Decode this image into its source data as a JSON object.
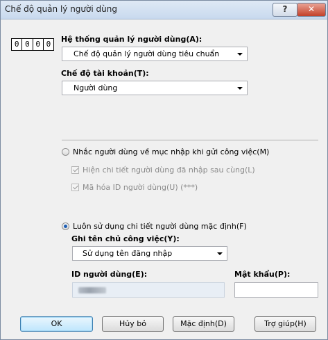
{
  "window": {
    "title": "Chế độ quản lý người dùng",
    "help_glyph": "?",
    "close_glyph": "✕"
  },
  "code_sticker": [
    "0",
    "0",
    "0",
    "0"
  ],
  "user_mgmt_system": {
    "label": "Hệ thống quản lý người dùng(A):",
    "value": "Chế độ quản lý người dùng tiêu chuẩn"
  },
  "account_mode": {
    "label": "Chế độ tài khoản(T):",
    "value": "Người dùng"
  },
  "prompt_option": {
    "label": "Nhắc người dùng về mục nhập khi gửi công việc(M)",
    "selected": false
  },
  "show_last_details": {
    "label": "Hiện chi tiết người dùng đã nhập sau cùng(L)",
    "checked": true,
    "enabled": false
  },
  "encrypt_id": {
    "label": "Mã hóa ID người dùng(U) (***)",
    "checked": true,
    "enabled": false
  },
  "default_option": {
    "label": "Luôn sử dụng chi tiết người dùng mặc định(F)",
    "selected": true
  },
  "job_owner": {
    "label": "Ghi tên chủ công việc(Y):",
    "value": "Sử dụng tên đăng nhập"
  },
  "user_id": {
    "label": "ID người dùng(E):",
    "value": ""
  },
  "password": {
    "label": "Mật khẩu(P):",
    "value": ""
  },
  "buttons": {
    "ok": "OK",
    "cancel": "Hủy bỏ",
    "default": "Mặc định(D)",
    "help": "Trợ giúp(H)"
  }
}
